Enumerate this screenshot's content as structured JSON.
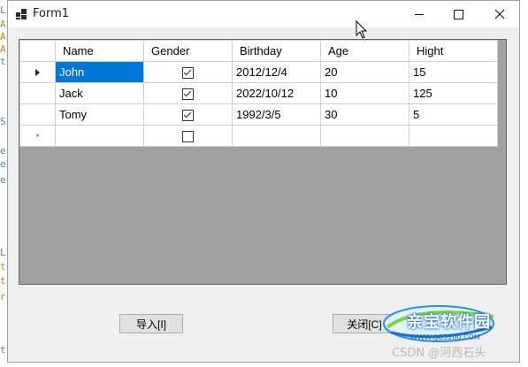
{
  "window": {
    "title": "Form1"
  },
  "grid": {
    "columns": [
      "Name",
      "Gender",
      "Birthday",
      "Age",
      "Hight"
    ],
    "rows": [
      {
        "name": "John",
        "gender_checked": true,
        "birthday": "2012/12/4",
        "age": "20",
        "hight": "15",
        "current": true
      },
      {
        "name": "Jack",
        "gender_checked": true,
        "birthday": "2022/10/12",
        "age": "10",
        "hight": "125"
      },
      {
        "name": "Tomy",
        "gender_checked": true,
        "birthday": "1992/3/5",
        "age": "30",
        "hight": "5"
      }
    ],
    "new_row_marker": "*",
    "selection_color": "#0078d7"
  },
  "buttons": {
    "import_label": "导入[I]",
    "close_label": "关闭[C]"
  },
  "watermark": {
    "logo_text": "亲宝软件园",
    "url": "WWW.QB5200.COM",
    "csdn": "CSDN @河西石头"
  },
  "background_code": [
    "L",
    "A",
    "A",
    "A",
    "t",
    "S",
    "e",
    "e",
    "e",
    "L",
    "t",
    "t",
    "r",
    "t"
  ]
}
